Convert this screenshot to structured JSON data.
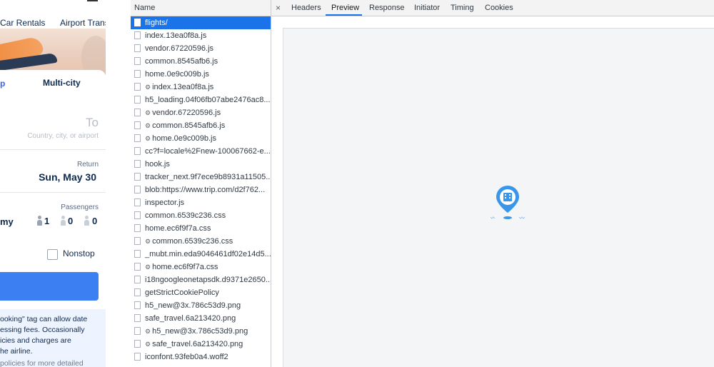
{
  "mobile": {
    "nav_tabs": [
      "Car Rentals",
      "Airport Trans"
    ],
    "trip_tabs": {
      "left": "p",
      "multi_city": "Multi-city"
    },
    "to_label": "To",
    "to_placeholder": "Country, city, or airport",
    "return_label": "Return",
    "return_date": "Sun, May 30",
    "passengers_label": "Passengers",
    "cabin_class_partial": "my",
    "passenger_counts": [
      "1",
      "0",
      "0"
    ],
    "nonstop_label": "Nonstop",
    "notice_lines": [
      "ooking\" tag can allow date",
      "essing fees. Occasionally",
      "icies and charges are",
      "he airline.",
      "policies for more detailed"
    ]
  },
  "network": {
    "name_header": "Name",
    "requests": [
      {
        "name": "flights/",
        "gear": false,
        "selected": true,
        "icon": "document-icon"
      },
      {
        "name": "index.13ea0f8a.js",
        "gear": false
      },
      {
        "name": "vendor.67220596.js",
        "gear": false
      },
      {
        "name": "common.8545afb6.js",
        "gear": false
      },
      {
        "name": "home.0e9c009b.js",
        "gear": false
      },
      {
        "name": "index.13ea0f8a.js",
        "gear": true
      },
      {
        "name": "h5_loading.04f06fb07abe2476ac8...",
        "gear": false
      },
      {
        "name": "vendor.67220596.js",
        "gear": true
      },
      {
        "name": "common.8545afb6.js",
        "gear": true
      },
      {
        "name": "home.0e9c009b.js",
        "gear": true
      },
      {
        "name": "cc?f=locale%2Fnew-100067662-e...",
        "gear": false
      },
      {
        "name": "hook.js",
        "gear": false
      },
      {
        "name": "tracker_next.9f7ece9b8931a11505...",
        "gear": false
      },
      {
        "name": "blob:https://www.trip.com/d2f762...",
        "gear": false
      },
      {
        "name": "inspector.js",
        "gear": false
      },
      {
        "name": "common.6539c236.css",
        "gear": false
      },
      {
        "name": "home.ec6f9f7a.css",
        "gear": false
      },
      {
        "name": "common.6539c236.css",
        "gear": true
      },
      {
        "name": "_mubt.min.eda9046461df02e14d5...",
        "gear": false
      },
      {
        "name": "home.ec6f9f7a.css",
        "gear": true
      },
      {
        "name": "i18ngoogleonetapsdk.d9371e2650...",
        "gear": false
      },
      {
        "name": "getStrictCookiePolicy",
        "gear": false
      },
      {
        "name": "h5_new@3x.786c53d9.png",
        "gear": false
      },
      {
        "name": "safe_travel.6a213420.png",
        "gear": false
      },
      {
        "name": "h5_new@3x.786c53d9.png",
        "gear": true
      },
      {
        "name": "safe_travel.6a213420.png",
        "gear": true
      },
      {
        "name": "iconfont.93feb0a4.woff2",
        "gear": false
      }
    ]
  },
  "detail": {
    "close_glyph": "×",
    "tabs": [
      "Headers",
      "Preview",
      "Response",
      "Initiator",
      "Timing",
      "Cookies"
    ],
    "active_tab": "Preview",
    "colors": {
      "accent": "#1a73e8",
      "loader_blue": "#3a96e8"
    }
  }
}
